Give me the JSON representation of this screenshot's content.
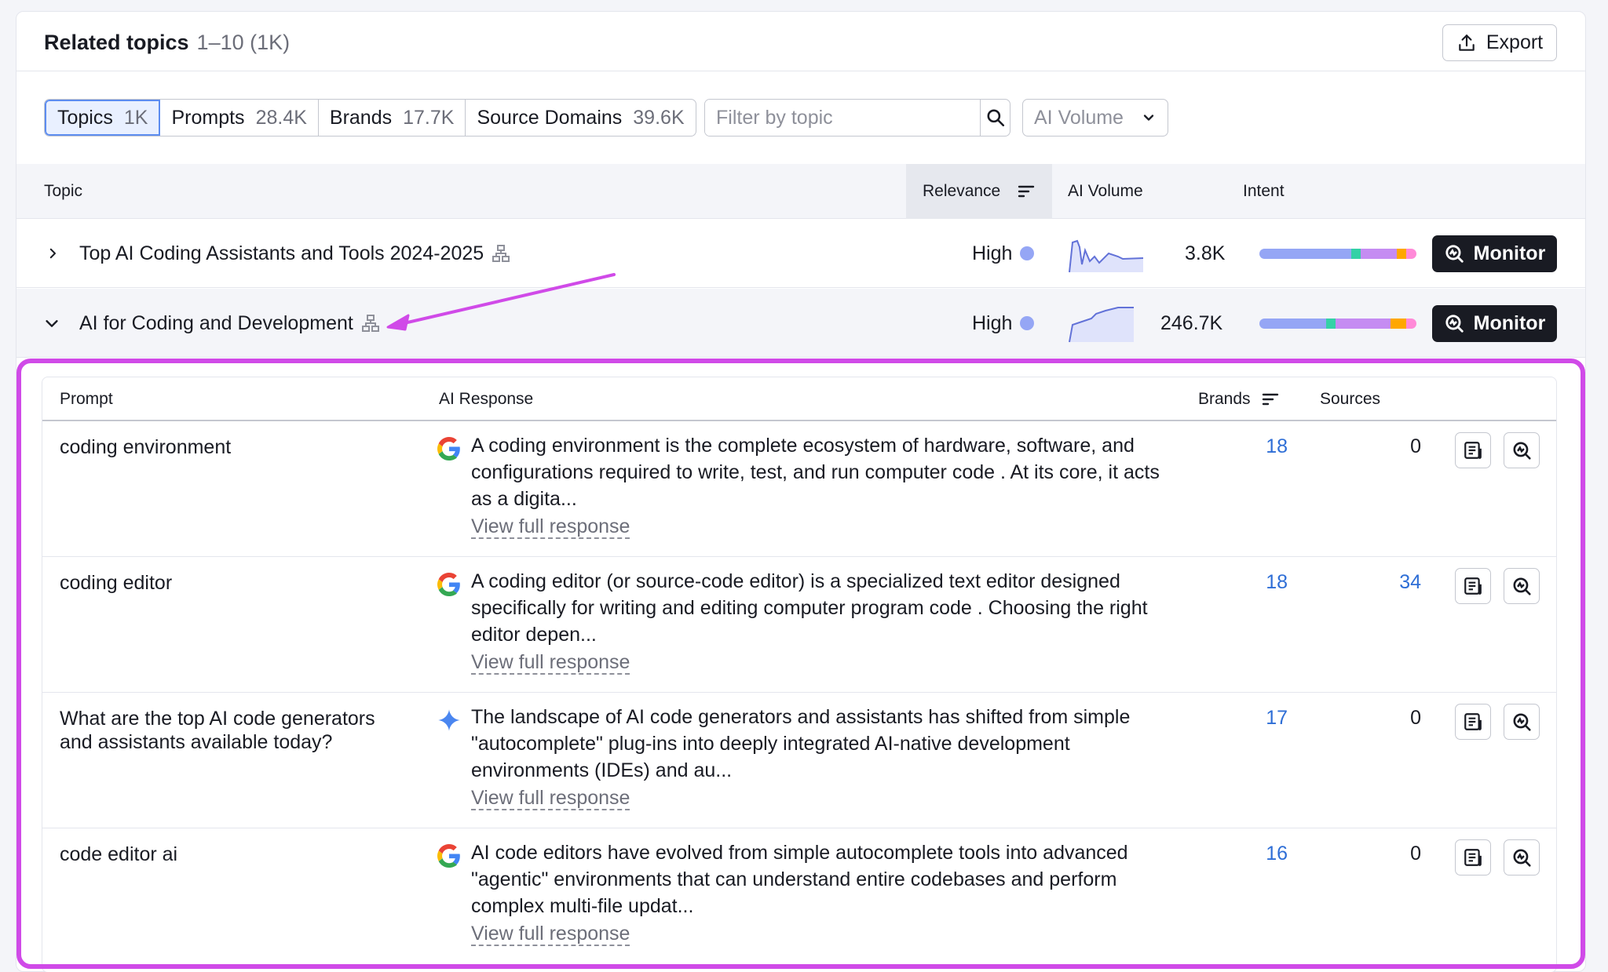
{
  "header": {
    "title": "Related topics",
    "count": "1–10 (1K)",
    "export_label": "Export"
  },
  "tabs": [
    {
      "label": "Topics",
      "count": "1K",
      "active": true
    },
    {
      "label": "Prompts",
      "count": "28.4K",
      "active": false
    },
    {
      "label": "Brands",
      "count": "17.7K",
      "active": false
    },
    {
      "label": "Source Domains",
      "count": "39.6K",
      "active": false
    }
  ],
  "filter": {
    "placeholder": "Filter by topic"
  },
  "volume_select": {
    "label": "AI Volume"
  },
  "table": {
    "columns": {
      "topic": "Topic",
      "relevance": "Relevance",
      "volume": "AI Volume",
      "intent": "Intent"
    },
    "rows": [
      {
        "topic": "Top AI Coding Assistants and Tools 2024-2025",
        "relevance": "High",
        "volume": "3.8K",
        "monitor": "Monitor",
        "expanded": false
      },
      {
        "topic": "AI for Coding and Development",
        "relevance": "High",
        "volume": "246.7K",
        "monitor": "Monitor",
        "expanded": true
      }
    ]
  },
  "intent_colors": [
    "#95a6f5",
    "#34d1a6",
    "#c58cf2",
    "#ffa700",
    "#ff8ad8"
  ],
  "prompts_table": {
    "columns": {
      "prompt": "Prompt",
      "response": "AI Response",
      "brands": "Brands",
      "sources": "Sources"
    },
    "view_full_label": "View full response",
    "rows": [
      {
        "prompt": "coding environment",
        "engine_icon": "google-icon",
        "response": "A coding environment is the complete ecosystem of hardware, software, and configurations required to write, test, and run computer code . At its core, it acts as a digita...",
        "brands": "18",
        "sources": "0"
      },
      {
        "prompt": "coding editor",
        "engine_icon": "google-icon",
        "response": "A coding editor (or source-code editor) is a specialized text editor designed specifically for writing and editing computer program code . Choosing the right editor depen...",
        "brands": "18",
        "sources": "34"
      },
      {
        "prompt": "What are the top AI code generators and assistants available today?",
        "engine_icon": "gemini-icon",
        "response": "The landscape of AI code generators and assistants has shifted from simple \"autocomplete\" plug-ins into deeply integrated AI-native development environments (IDEs) and au...",
        "brands": "17",
        "sources": "0"
      },
      {
        "prompt": "code editor ai",
        "engine_icon": "google-icon",
        "response": "AI code editors have evolved from simple autocomplete tools into advanced \"agentic\" environments that can understand entire codebases and perform complex multi-file updat...",
        "brands": "16",
        "sources": "0"
      }
    ]
  }
}
